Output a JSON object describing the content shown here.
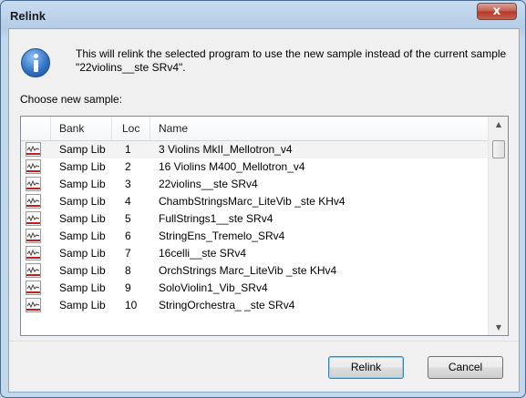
{
  "window": {
    "title": "Relink",
    "close_glyph": "x"
  },
  "message": "This will relink the selected program to use the new sample instead of the current sample \"22violins__ste SRv4\".",
  "choose_label": "Choose new sample:",
  "columns": [
    "Bank",
    "Loc",
    "Name"
  ],
  "rows": [
    {
      "bank": "Samp Lib",
      "loc": "1",
      "name": "3 Violins MkII_Mellotron_v4",
      "selected": true
    },
    {
      "bank": "Samp Lib",
      "loc": "2",
      "name": "16 Violins M400_Mellotron_v4"
    },
    {
      "bank": "Samp Lib",
      "loc": "3",
      "name": "22violins__ste SRv4"
    },
    {
      "bank": "Samp Lib",
      "loc": "4",
      "name": "ChambStringsMarc_LiteVib _ste KHv4"
    },
    {
      "bank": "Samp Lib",
      "loc": "5",
      "name": "FullStrings1__ste SRv4"
    },
    {
      "bank": "Samp Lib",
      "loc": "6",
      "name": "StringEns_Tremelo_SRv4"
    },
    {
      "bank": "Samp Lib",
      "loc": "7",
      "name": "16celli__ste SRv4"
    },
    {
      "bank": "Samp Lib",
      "loc": "8",
      "name": "OrchStrings Marc_LiteVib _ste KHv4"
    },
    {
      "bank": "Samp Lib",
      "loc": "9",
      "name": "SoloViolin1_Vib_SRv4"
    },
    {
      "bank": "Samp Lib",
      "loc": "10",
      "name": "StringOrchestra_ _ste SRv4"
    }
  ],
  "buttons": {
    "relink": "Relink",
    "cancel": "Cancel"
  },
  "icons": {
    "info": "info-icon",
    "sample": "waveform-icon"
  }
}
